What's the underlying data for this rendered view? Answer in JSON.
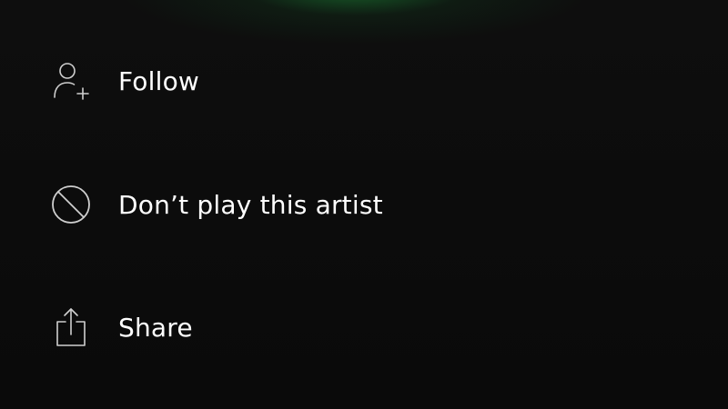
{
  "menu": {
    "items": [
      {
        "label": "Follow",
        "icon": "follow-user-icon"
      },
      {
        "label": "Don’t play this artist",
        "icon": "block-icon"
      },
      {
        "label": "Share",
        "icon": "share-icon"
      }
    ]
  },
  "colors": {
    "background": "#0b0b0b",
    "text": "#ffffff",
    "icon_stroke": "#cfcfcf",
    "accent_glow": "#1e963c"
  }
}
